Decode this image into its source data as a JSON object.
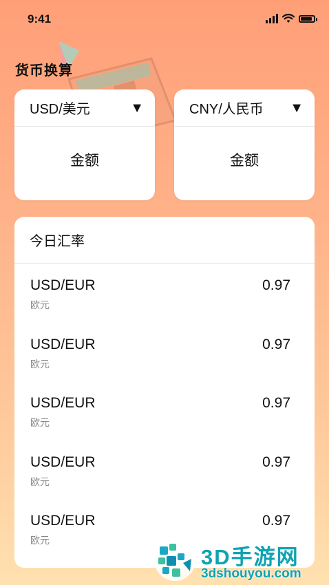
{
  "status_bar": {
    "time": "9:41"
  },
  "page": {
    "title": "货币换算"
  },
  "converter": {
    "from": {
      "currency": "USD/美元",
      "dropdown_icon": "▼",
      "amount_label": "金额"
    },
    "to": {
      "currency": "CNY/人民币",
      "dropdown_icon": "▼",
      "amount_label": "金额"
    }
  },
  "rates": {
    "title": "今日汇率",
    "items": [
      {
        "pair": "USD/EUR",
        "name": "欧元",
        "value": "0.97"
      },
      {
        "pair": "USD/EUR",
        "name": "欧元",
        "value": "0.97"
      },
      {
        "pair": "USD/EUR",
        "name": "欧元",
        "value": "0.97"
      },
      {
        "pair": "USD/EUR",
        "name": "欧元",
        "value": "0.97"
      },
      {
        "pair": "USD/EUR",
        "name": "欧元",
        "value": "0.97"
      }
    ]
  },
  "watermark": {
    "title": "3D手游网",
    "url": "3dshouyou.com"
  },
  "colors": {
    "background_top": "#ff9f78",
    "background_bottom": "#ffe1b0",
    "watermark": "#0fa3b1"
  }
}
